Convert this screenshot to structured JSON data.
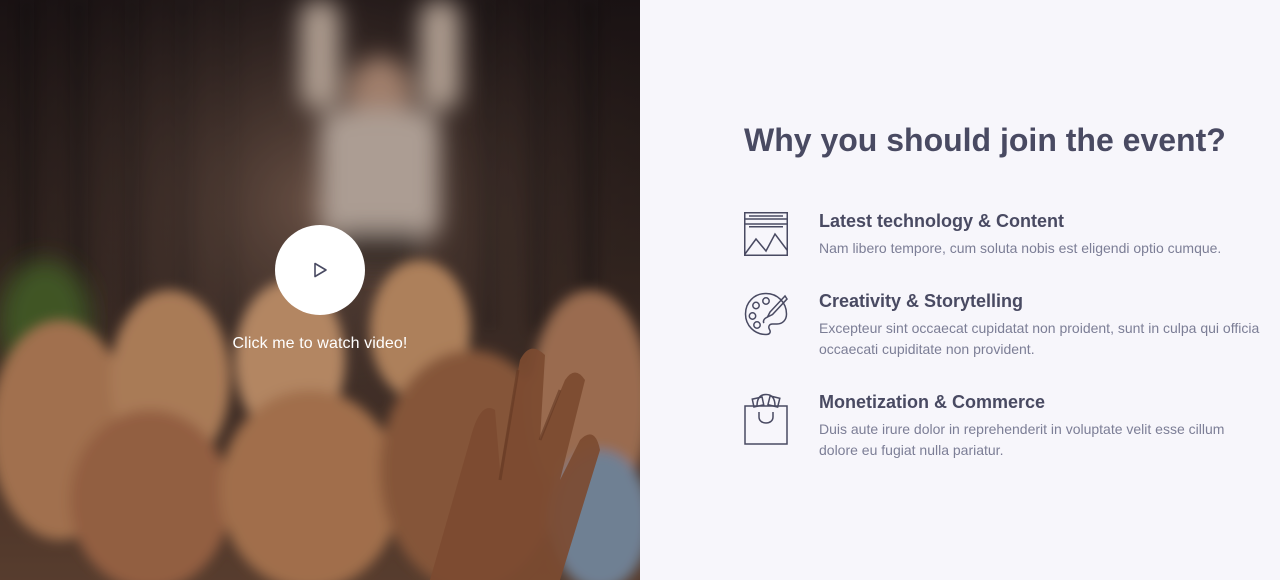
{
  "video": {
    "caption": "Click me to watch video!",
    "play_icon": "play-icon"
  },
  "section": {
    "heading": "Why you should join the event?"
  },
  "features": [
    {
      "icon": "image-frame-icon",
      "title": "Latest technology & Content",
      "description": "Nam libero tempore, cum soluta nobis est eligendi optio cumque."
    },
    {
      "icon": "palette-icon",
      "title": "Creativity & Storytelling",
      "description": "Excepteur sint occaecat cupidatat non proident, sunt in culpa qui officia occaecati cupiditate non provident."
    },
    {
      "icon": "shopping-bag-icon",
      "title": "Monetization & Commerce",
      "description": "Duis aute irure dolor in reprehenderit in voluptate velit esse cillum dolore eu fugiat nulla pariatur."
    }
  ],
  "colors": {
    "heading": "#494a62",
    "body_text": "#7c7e96",
    "panel_background": "#f7f6fb",
    "play_button": "#ffffff"
  }
}
